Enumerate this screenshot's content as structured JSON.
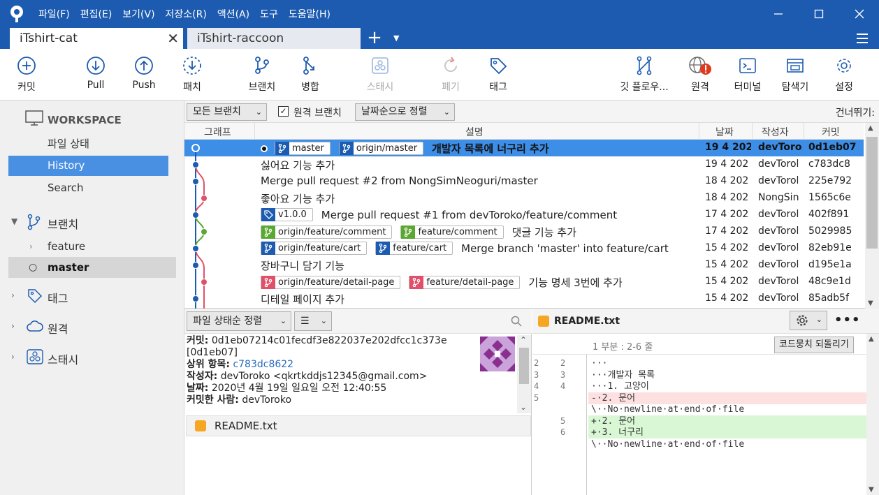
{
  "menu": [
    "파일(F)",
    "편집(E)",
    "보기(V)",
    "저장소(R)",
    "액션(A)",
    "도구",
    "도움말(H)"
  ],
  "tabs": {
    "active": "iTshirt-cat",
    "inactive": "iTshirt-raccoon"
  },
  "toolbar": {
    "commit": "커밋",
    "pull": "Pull",
    "push": "Push",
    "fetch": "패치",
    "branch": "브랜치",
    "merge": "병합",
    "stash": "스태시",
    "discard": "폐기",
    "tag": "태그",
    "gitflow": "깃 플로우...",
    "remote": "원격",
    "terminal": "터미널",
    "explorer": "탐색기",
    "settings": "설정"
  },
  "sidebar": {
    "workspace": "WORKSPACE",
    "items": [
      "파일 상태",
      "History",
      "Search"
    ],
    "branches_label": "브랜치",
    "branches": [
      "feature",
      "master"
    ],
    "tags_label": "태그",
    "remotes_label": "원격",
    "stashes_label": "스태시"
  },
  "filter": {
    "branches": "모든 브랜치",
    "remote_branches": "원격 브랜치",
    "remote_checked": true,
    "sort": "날짜순으로 정렬",
    "skip": "건너뛰기:"
  },
  "columns": {
    "graph": "그래프",
    "description": "설명",
    "date": "날짜",
    "author": "작성자",
    "commit": "커밋"
  },
  "commits": [
    {
      "refs": [
        {
          "type": "branch",
          "color": "#1c5bb0",
          "label": "master"
        },
        {
          "type": "branch",
          "color": "#1c5bb0",
          "label": "origin/master"
        }
      ],
      "message": "개발자 목록에 너구리 추가",
      "date": "19 4 202",
      "author": "devToro",
      "hash": "0d1eb07",
      "head": true
    },
    {
      "refs": [],
      "message": "싫어요 기능 추가",
      "date": "19 4 202",
      "author": "devTorol",
      "hash": "c783dc8"
    },
    {
      "refs": [],
      "message": "Merge pull request #2 from NongSimNeoguri/master",
      "date": "18 4 202",
      "author": "devTorol",
      "hash": "225e792"
    },
    {
      "refs": [],
      "message": "좋아요 기능 추가",
      "date": "18 4 202",
      "author": "NongSin",
      "hash": "1565c6e"
    },
    {
      "refs": [
        {
          "type": "tag",
          "color": "#1c5bb0",
          "label": "v1.0.0"
        }
      ],
      "message": "Merge pull request #1 from devToroko/feature/comment",
      "date": "17 4 202",
      "author": "devTorol",
      "hash": "402f891"
    },
    {
      "refs": [
        {
          "type": "branch",
          "color": "#5aa832",
          "label": "origin/feature/comment"
        },
        {
          "type": "branch",
          "color": "#5aa832",
          "label": "feature/comment"
        }
      ],
      "message": "댓글 기능 추가",
      "date": "17 4 202",
      "author": "devTorol",
      "hash": "5029985"
    },
    {
      "refs": [
        {
          "type": "branch",
          "color": "#1c5bb0",
          "label": "origin/feature/cart"
        },
        {
          "type": "branch",
          "color": "#1c5bb0",
          "label": "feature/cart"
        }
      ],
      "message": "Merge branch 'master' into feature/cart",
      "date": "15 4 202",
      "author": "devTorol",
      "hash": "82eb91e"
    },
    {
      "refs": [],
      "message": "장바구니 담기 기능",
      "date": "15 4 202",
      "author": "devTorol",
      "hash": "d195e1a"
    },
    {
      "refs": [
        {
          "type": "branch",
          "color": "#e0506a",
          "label": "origin/feature/detail-page"
        },
        {
          "type": "branch",
          "color": "#e0506a",
          "label": "feature/detail-page"
        }
      ],
      "message": "기능 명세 3번에 추가",
      "date": "15 4 202",
      "author": "devTorol",
      "hash": "48c9e1d"
    },
    {
      "refs": [],
      "message": "디테일 페이지 추가",
      "date": "15 4 202",
      "author": "devTorol",
      "hash": "85adb5f"
    }
  ],
  "bottom": {
    "sort": "파일 상태순 정렬",
    "view": "☰",
    "details": {
      "commit_label": "커밋:",
      "commit_value": "0d1eb07214c01fecdf3e822037e202dfcc1c373e",
      "commit_short": "[0d1eb07]",
      "parents_label": "상위 항목:",
      "parents_value": "c783dc8622",
      "author_label": "작성자:",
      "author_value": "devToroko <qkrtkddjs12345@gmail.com>",
      "date_label": "날짜:",
      "date_value": "2020년 4월 19일 일요일 오전 12:40:55",
      "committer_label": "커밋한 사람:",
      "committer_value": "devToroko"
    },
    "file": "README.txt"
  },
  "diff": {
    "file": "README.txt",
    "hunk": "1 부분 : 2-6 줄",
    "revert_button": "코드뭉치 되돌리기",
    "lines": [
      {
        "kind": "ctx",
        "old": "2",
        "new": "2",
        "text": "···"
      },
      {
        "kind": "ctx",
        "old": "3",
        "new": "3",
        "text": "···개발자 목록"
      },
      {
        "kind": "ctx",
        "old": "4",
        "new": "4",
        "text": "···1. 고양이"
      },
      {
        "kind": "del",
        "old": "5",
        "new": "",
        "text": "-·2. 문어"
      },
      {
        "kind": "meta",
        "old": "",
        "new": "",
        "text": "\\··No·newline·at·end·of·file"
      },
      {
        "kind": "add",
        "old": "",
        "new": "5",
        "text": "+·2. 문어"
      },
      {
        "kind": "add",
        "old": "",
        "new": "6",
        "text": "+·3. 너구리"
      },
      {
        "kind": "meta",
        "old": "",
        "new": "",
        "text": "\\··No·newline·at·end·of·file"
      }
    ]
  },
  "colors": {
    "titlebar": "#1c5bb0",
    "selection": "#3d8ee6",
    "sidebar_selection": "#4a90e2",
    "graph_blue": "#1c5bb0",
    "graph_pink": "#e0506a",
    "graph_green": "#5aa832"
  }
}
